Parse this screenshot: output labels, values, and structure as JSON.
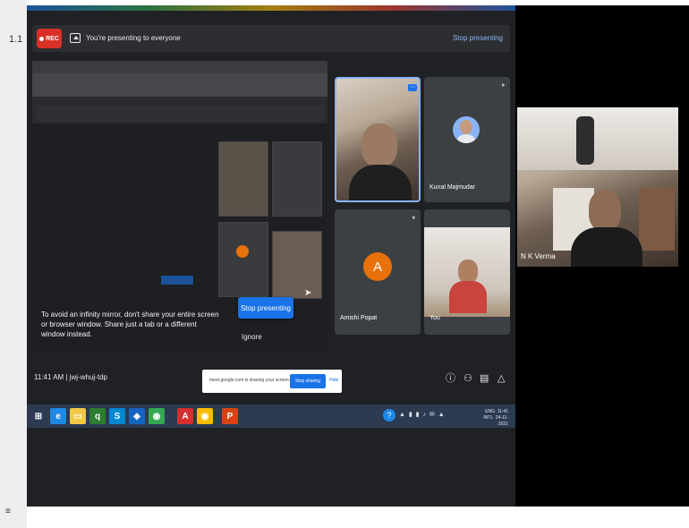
{
  "stage": {
    "left_label": "1.1"
  },
  "topbar": {
    "rec_label": "REC",
    "present_text": "You're presenting to everyone",
    "stop_link": "Stop presenting"
  },
  "mirror": {
    "message": "To avoid an infinity mirror, don't share your entire screen or browser window. Share just a tab or a different window instead.",
    "stop_button": "Stop presenting",
    "ignore": "Ignore"
  },
  "tiles": [
    {
      "name": ""
    },
    {
      "name": "Kunal Majmudar"
    },
    {
      "name": "Amishi Popat",
      "initial": "A"
    },
    {
      "name": "You"
    }
  ],
  "bottombar": {
    "time": "11:41 AM  |  jwj-whuj-tdp",
    "sharing_text": "meet.google.com is sharing your screen.",
    "stop_sharing": "Stop sharing",
    "hide": "Hide"
  },
  "tray": {
    "lang": "ENG",
    "region": "INTL",
    "time": "11:41",
    "date": "24-11-2021"
  },
  "self": {
    "name": "N K Verma"
  },
  "colors": {
    "accent": "#1a73e8",
    "rec": "#d93025",
    "avatar": "#e8710a"
  }
}
